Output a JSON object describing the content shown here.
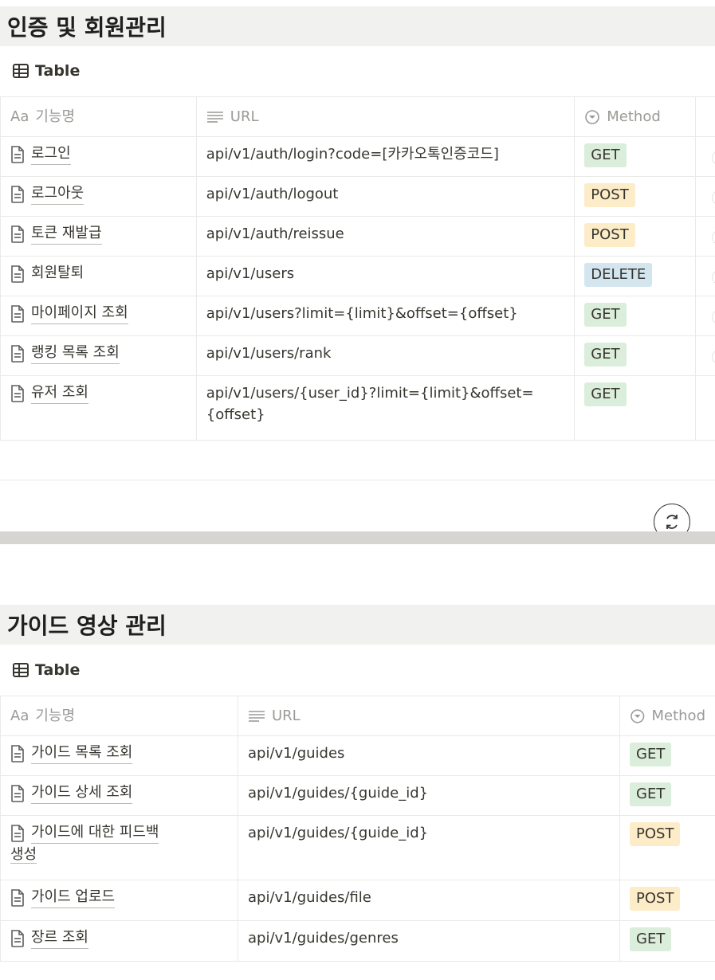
{
  "sections": [
    {
      "title": "인증 및 회원관리",
      "view_label": "Table",
      "columns": {
        "name": "기능명",
        "name_prefix": "Aa",
        "url": "URL",
        "method": "Method"
      },
      "rows": [
        {
          "name": "로그인",
          "url": "api/v1/auth/login?code=[카카오톡인증코드]",
          "method": "GET"
        },
        {
          "name": "로그아웃",
          "url": "api/v1/auth/logout",
          "method": "POST"
        },
        {
          "name": "토큰 재발급",
          "url": "api/v1/auth/reissue",
          "method": "POST"
        },
        {
          "name": "회원탈퇴",
          "url": "api/v1/users",
          "method": "DELETE"
        },
        {
          "name": "마이페이지 조회",
          "url": "api/v1/users?limit={limit}&offset={offset}",
          "method": "GET"
        },
        {
          "name": "랭킹 목록 조회",
          "url": "api/v1/users/rank",
          "method": "GET"
        },
        {
          "name": "유저 조회",
          "url": "api/v1/users/{user_id}?limit={limit}&offset=",
          "url_line2": "{offset}",
          "method": "GET"
        }
      ]
    },
    {
      "title": "가이드 영상 관리",
      "view_label": "Table",
      "columns": {
        "name": "기능명",
        "name_prefix": "Aa",
        "url": "URL",
        "method": "Method"
      },
      "rows": [
        {
          "name": "가이드 목록 조회",
          "url": "api/v1/guides",
          "method": "GET"
        },
        {
          "name": "가이드 상세 조회",
          "url": "api/v1/guides/{guide_id}",
          "method": "GET"
        },
        {
          "name": "가이드에 대한 피드백",
          "name_line2": "생성",
          "url": "api/v1/guides/{guide_id}",
          "method": "POST"
        },
        {
          "name": "가이드 업로드",
          "url": "api/v1/guides/file",
          "method": "POST"
        },
        {
          "name": "장르 조회",
          "url": "api/v1/guides/genres",
          "method": "GET"
        }
      ]
    }
  ],
  "method_colors": {
    "GET": "#dbeddb",
    "POST": "#fdecc8",
    "DELETE": "#d3e5ef"
  }
}
